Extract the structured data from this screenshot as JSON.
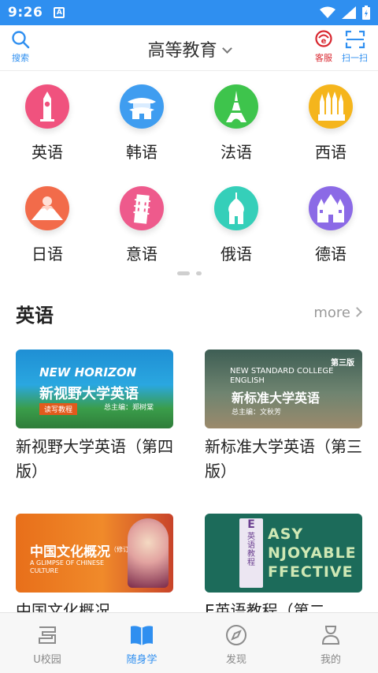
{
  "status_bar": {
    "time": "9:26",
    "notification_icon": "A"
  },
  "header": {
    "search_label": "搜索",
    "title": "高等教育",
    "service_label": "客服",
    "scan_label": "扫一扫"
  },
  "languages": [
    {
      "label": "英语",
      "icon": "big-ben-icon",
      "color": "#f0527e"
    },
    {
      "label": "韩语",
      "icon": "palace-icon",
      "color": "#3f9df0"
    },
    {
      "label": "法语",
      "icon": "eiffel-tower-icon",
      "color": "#3ec44c"
    },
    {
      "label": "西语",
      "icon": "sagrada-familia-icon",
      "color": "#f5b51c"
    },
    {
      "label": "日语",
      "icon": "mount-fuji-icon",
      "color": "#f26b4a"
    },
    {
      "label": "意语",
      "icon": "pisa-tower-icon",
      "color": "#ee5a8c"
    },
    {
      "label": "俄语",
      "icon": "onion-dome-icon",
      "color": "#35cfb9"
    },
    {
      "label": "德语",
      "icon": "castle-icon",
      "color": "#8b6ae6"
    }
  ],
  "section": {
    "title": "英语",
    "more_label": "more"
  },
  "books": [
    {
      "title": "新视野大学英语（第四版）",
      "cover_text": "新视野大学英语",
      "cover_sub": "NEW HORIZON",
      "cover_tag": "读写教程",
      "cover_editor": "总主编：郑树棠",
      "cover_color": "#1f8fd4"
    },
    {
      "title": "新标准大学英语（第三版）",
      "cover_text": "新标准大学英语",
      "cover_sub": "NEW STANDARD COLLEGE ENGLISH",
      "cover_tag": "第三版",
      "cover_editor": "总主编：文秋芳",
      "cover_color": "#4f6a5a"
    },
    {
      "title": "中国文化概况",
      "cover_text": "中国文化概况",
      "cover_sub": "A GLIMPSE OF CHINESE CULTURE",
      "cover_tag": "（修订版）",
      "cover_editor": "",
      "cover_color": "#e6721e"
    },
    {
      "title": "E英语教程（第二",
      "cover_text": "英语教程",
      "cover_sub": "ASY NJOYABLE FFECTIVE",
      "cover_tag": "E",
      "cover_editor": "",
      "cover_color": "#1c6b5a"
    }
  ],
  "bottom_nav": [
    {
      "label": "U校园",
      "icon": "u-campus-icon",
      "active": false
    },
    {
      "label": "随身学",
      "icon": "book-icon",
      "active": true
    },
    {
      "label": "发现",
      "icon": "compass-icon",
      "active": false
    },
    {
      "label": "我的",
      "icon": "profile-icon",
      "active": false
    }
  ],
  "colors": {
    "accent": "#2f8ff0",
    "service_red": "#d8262e"
  }
}
